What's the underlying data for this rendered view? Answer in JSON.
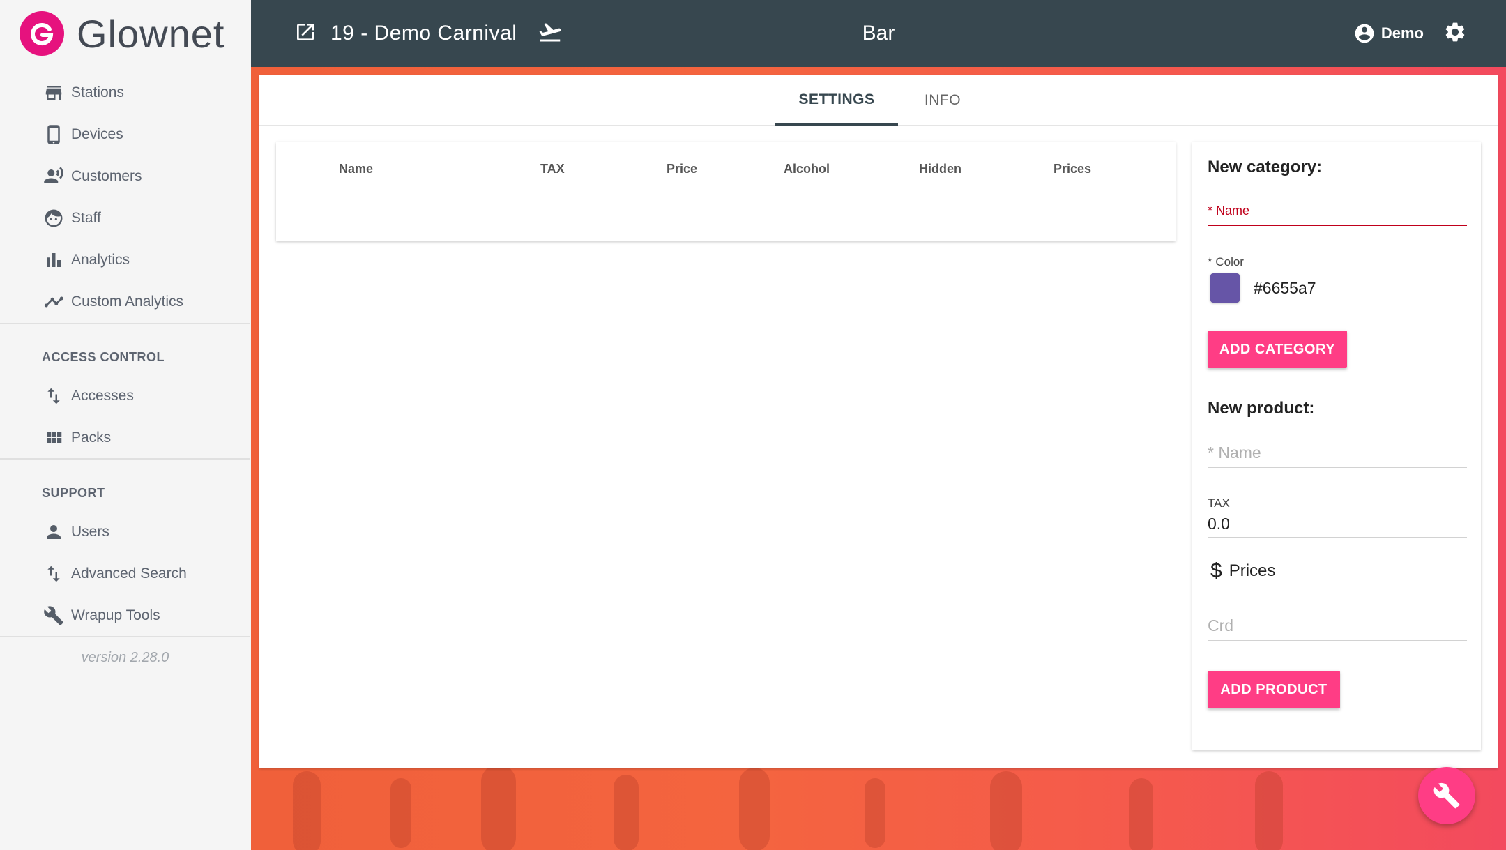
{
  "brand": {
    "name": "Glownet"
  },
  "sidebar": {
    "items": [
      {
        "label": "Stations",
        "icon": "store-icon"
      },
      {
        "label": "Devices",
        "icon": "phone-icon"
      },
      {
        "label": "Customers",
        "icon": "customers-icon"
      },
      {
        "label": "Staff",
        "icon": "face-icon"
      },
      {
        "label": "Analytics",
        "icon": "bar-chart-icon"
      },
      {
        "label": "Custom Analytics",
        "icon": "line-chart-icon"
      }
    ],
    "access_control": {
      "title": "ACCESS CONTROL",
      "items": [
        {
          "label": "Accesses",
          "icon": "swap-vert-icon"
        },
        {
          "label": "Packs",
          "icon": "grid-icon"
        }
      ]
    },
    "support": {
      "title": "SUPPORT",
      "items": [
        {
          "label": "Users",
          "icon": "person-icon"
        },
        {
          "label": "Advanced Search",
          "icon": "swap-vert-icon"
        },
        {
          "label": "Wrapup Tools",
          "icon": "wrench-icon"
        }
      ]
    },
    "version": "version 2.28.0"
  },
  "header": {
    "event_title": "19 - Demo Carnival",
    "station_title": "Bar",
    "user_name": "Demo"
  },
  "tabs": [
    {
      "label": "SETTINGS",
      "active": true
    },
    {
      "label": "INFO",
      "active": false
    }
  ],
  "table": {
    "columns": [
      "Name",
      "TAX",
      "Price",
      "Alcohol",
      "Hidden",
      "Prices"
    ],
    "rows": []
  },
  "new_category": {
    "title": "New category:",
    "name_label": "* Name",
    "color_label": "* Color",
    "color_value": "#6655a7",
    "button_label": "ADD CATEGORY"
  },
  "new_product": {
    "title": "New product:",
    "name_placeholder": "* Name",
    "tax_label": "TAX",
    "tax_value": "0.0",
    "prices_label": "Prices",
    "crd_placeholder": "Crd",
    "button_label": "ADD PRODUCT"
  },
  "colors": {
    "header_bg": "#37474f",
    "accent": "#ff3d85",
    "brand": "#e6127e",
    "required": "#c0001b"
  }
}
